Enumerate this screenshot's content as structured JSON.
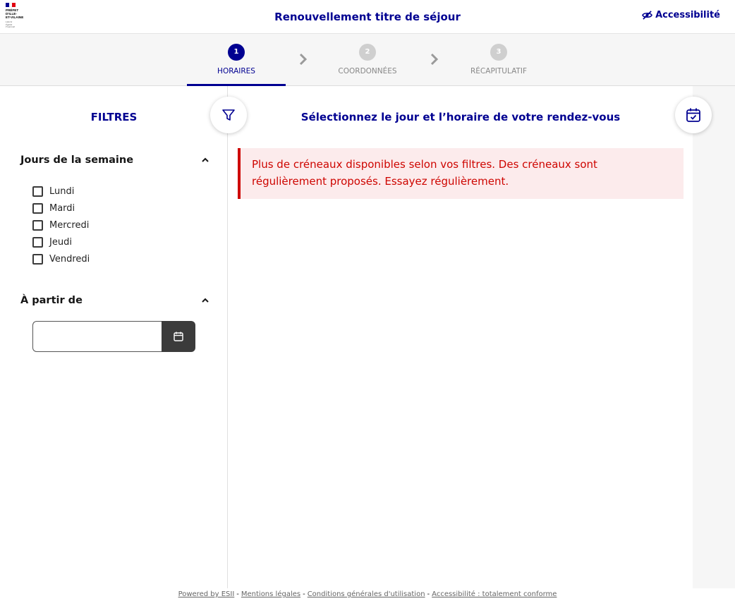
{
  "header": {
    "logo": {
      "lines": [
        "PRÉFET",
        "D'ILLE-",
        "ET-VILAINE"
      ],
      "motto": [
        "Liberté",
        "Égalité",
        "Fraternité"
      ],
      "flag_colors": [
        "#000091",
        "#ffffff",
        "#e1000f"
      ]
    },
    "title": "Renouvellement titre de séjour",
    "accessibility_label": "Accessibilité",
    "accessibility_icon": "eye-slash-icon"
  },
  "stepper": {
    "steps": [
      {
        "number": "1",
        "label": "HORAIRES",
        "state": "active"
      },
      {
        "number": "2",
        "label": "COORDONNÉES",
        "state": "inactive"
      },
      {
        "number": "3",
        "label": "RÉCAPITULATIF",
        "state": "inactive"
      }
    ],
    "separator_icon": "chevron-right-icon"
  },
  "sidebar": {
    "title": "FILTRES",
    "toggle_icon": "filter-icon",
    "days_section": {
      "title": "Jours de la semaine",
      "days": [
        {
          "label": "Lundi",
          "checked": false
        },
        {
          "label": "Mardi",
          "checked": false
        },
        {
          "label": "Mercredi",
          "checked": false
        },
        {
          "label": "Jeudi",
          "checked": false
        },
        {
          "label": "Vendredi",
          "checked": false
        }
      ]
    },
    "date_section": {
      "title": "À partir de",
      "value": "",
      "button_icon": "calendar-icon"
    }
  },
  "main": {
    "title": "Sélectionnez le jour et l’horaire de votre rendez-vous",
    "toggle_icon": "calendar-check-icon",
    "alert": "Plus de créneaux disponibles selon vos filtres. Des créneaux sont régulièrement proposés. Essayez régulièrement."
  },
  "footer": {
    "links": [
      "Powered by ESII",
      "Mentions légales",
      "Conditions générales d'utilisation",
      "Accessibilité : totalement conforme"
    ],
    "separator": "-"
  },
  "colors": {
    "primary": "#000091",
    "error": "#ce0500",
    "error_bg": "#fcebec",
    "stepper_bg": "#f6f6f6"
  }
}
